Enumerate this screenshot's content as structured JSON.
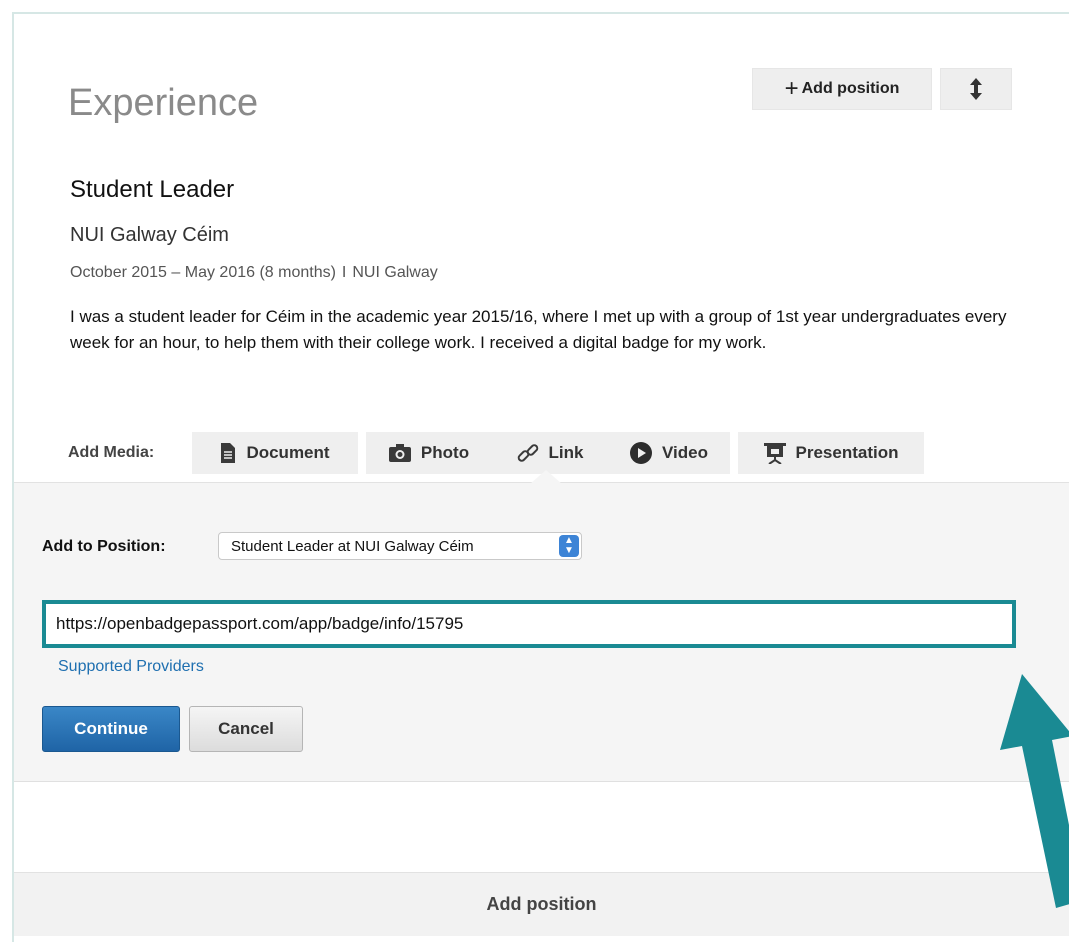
{
  "section": {
    "title": "Experience",
    "add_position_label": "Add position",
    "reorder_icon": "up-down-arrow-icon"
  },
  "position": {
    "title": "Student Leader",
    "company": "NUI Galway Céim",
    "dates": "October 2015 – May 2016 (8 months)",
    "separator": "I",
    "location": "NUI Galway",
    "description": "I was a student leader for Céim in the academic year 2015/16, where I met up with a group of 1st year undergraduates every week for an hour, to help them with their college work. I received a digital badge for my work."
  },
  "media": {
    "label": "Add Media:",
    "buttons": [
      {
        "label": "Document",
        "icon": "document-icon"
      },
      {
        "label": "Photo",
        "icon": "camera-icon"
      },
      {
        "label": "Link",
        "icon": "link-icon"
      },
      {
        "label": "Video",
        "icon": "play-icon"
      },
      {
        "label": "Presentation",
        "icon": "presentation-icon"
      }
    ],
    "active": "Link"
  },
  "link_form": {
    "add_to_label": "Add to Position:",
    "selected_position": "Student Leader at NUI Galway Céim",
    "url_value": "https://openbadgepassport.com/app/badge/info/15795",
    "providers_link": "Supported Providers",
    "continue_label": "Continue",
    "cancel_label": "Cancel"
  },
  "footer": {
    "add_position_label": "Add position"
  },
  "colors": {
    "highlight": "#1a8a93",
    "primary_button": "#2770b3",
    "link": "#1e6fb0"
  }
}
